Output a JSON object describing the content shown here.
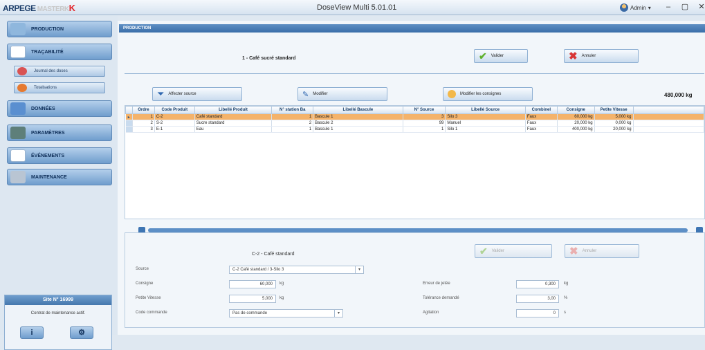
{
  "titlebar": {
    "brand": "ARPEGE",
    "brand_suffix": "MASTERK",
    "app_title": "DoseView Multi 5.01.01",
    "user": "Admin"
  },
  "sidebar": {
    "nav": [
      {
        "label": "PRODUCTION",
        "icon": "production-icon",
        "color": "#8fb7dd"
      },
      {
        "label": "TRAÇABILITÉ",
        "icon": "document-icon",
        "color": "#ffffff"
      },
      {
        "label": "DONNÉES",
        "icon": "data-icon",
        "color": "#5a8fd0"
      },
      {
        "label": "PARAMÈTRES",
        "icon": "parameters-icon",
        "color": "#5e7f7a"
      },
      {
        "label": "ÉVÉNEMENTS",
        "icon": "events-icon",
        "color": "#ffffff"
      },
      {
        "label": "MAINTENANCE",
        "icon": "tools-icon",
        "color": "#b9c5d3"
      }
    ],
    "sub": [
      {
        "label": "Journal des doses",
        "icon": "journal-icon",
        "color": "#d95353"
      },
      {
        "label": "Totalisations",
        "icon": "totals-icon",
        "color": "#e67a30"
      }
    ],
    "site": {
      "title": "Site N° 16999",
      "text": "Contrat de maintenance actif.",
      "info_glyph": "i",
      "gear_glyph": "⚙"
    }
  },
  "main": {
    "section": "PRODUCTION",
    "recipe_title": "1 - Café sucré standard",
    "validate": "Valider",
    "cancel": "Annuler",
    "assign_source": "Affecter source",
    "modify": "Modifier",
    "modify_setpoints": "Modifier les consignes",
    "total_weight": "480,000 kg"
  },
  "grid": {
    "columns": [
      "Ordre",
      "Code Produit",
      "Libellé Produit",
      "N° station Ba",
      "Libellé Bascule",
      "N° Source",
      "Libellé Source",
      "Combinel",
      "Consigne",
      "Petite Vitesse"
    ],
    "rows": [
      [
        "1",
        "C-2",
        "Café standard",
        "1",
        "Bascule 1",
        "3",
        "Silo 3",
        "Faux",
        "60,000 kg",
        "5,000 kg"
      ],
      [
        "2",
        "S-2",
        "Sucre standard",
        "2",
        "Bascule 2",
        "99",
        "Manuel",
        "Faux",
        "20,000 kg",
        "0,000 kg"
      ],
      [
        "3",
        "E-1",
        "Eau",
        "1",
        "Bascule 1",
        "1",
        "Silo 1",
        "Faux",
        "400,000 kg",
        "20,000 kg"
      ]
    ],
    "selected_marker": "▸"
  },
  "edit": {
    "title": "C-2 - Café standard",
    "validate": "Valider",
    "cancel": "Annuler",
    "source_label": "Source",
    "source_value": "C-2 Café standard / 3-Silo 3",
    "setpoint_label": "Consigne",
    "setpoint_value": "60,000",
    "slow_label": "Petite Vitesse",
    "slow_value": "5,000",
    "command_label": "Code commande",
    "command_value": "Pas de commande",
    "unit_kg": "kg",
    "jet_label": "Erreur de jetée",
    "jet_value": "0,300",
    "tol_label": "Tolérance demandé",
    "tol_value": "3,00",
    "tol_unit": "%",
    "agit_label": "Agitation",
    "agit_value": "0",
    "agit_unit": "s"
  }
}
